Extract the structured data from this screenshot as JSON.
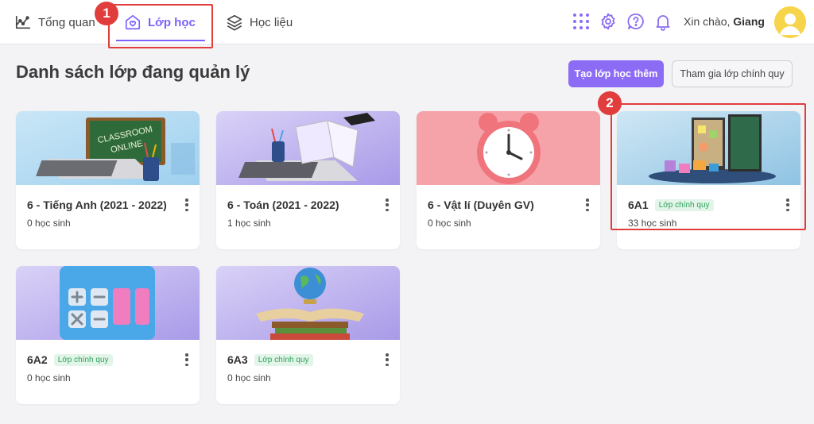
{
  "nav": {
    "overview_label": "Tổng quan",
    "class_label": "Lớp học",
    "material_label": "Học liệu"
  },
  "header": {
    "greeting_prefix": "Xin chào,",
    "user_name": "Giang"
  },
  "annotations": {
    "step1": "1",
    "step2": "2"
  },
  "page": {
    "title": "Danh sách lớp đang quản lý",
    "create_button": "Tạo lớp học thêm",
    "join_button": "Tham gia lớp chính quy"
  },
  "classes": [
    {
      "name": "6 - Tiếng Anh (2021 - 2022)",
      "tag": "",
      "students": "0 học sinh",
      "thumb_text_1": "CLASSROOM",
      "thumb_text_2": "ONLINE"
    },
    {
      "name": "6 - Toán (2021 - 2022)",
      "tag": "",
      "students": "1 học sinh"
    },
    {
      "name": "6 - Vật lí (Duyên GV)",
      "tag": "",
      "students": "0 học sinh"
    },
    {
      "name": "6A1",
      "tag": "Lớp chính quy",
      "students": "33 học sinh"
    },
    {
      "name": "6A2",
      "tag": "Lớp chính quy",
      "students": "0 học sinh"
    },
    {
      "name": "6A3",
      "tag": "Lớp chính quy",
      "students": "0 học sinh"
    }
  ],
  "colors": {
    "accent": "#7b61ff",
    "primary_button": "#8c6cf5",
    "annotation_red": "#e23d3d",
    "tag_green": "#2e9e5a"
  },
  "icons": [
    "chart-icon",
    "house-heart-icon",
    "layers-icon",
    "apps-grid-icon",
    "gear-icon",
    "help-icon",
    "bell-icon",
    "kebab-menu-icon"
  ]
}
